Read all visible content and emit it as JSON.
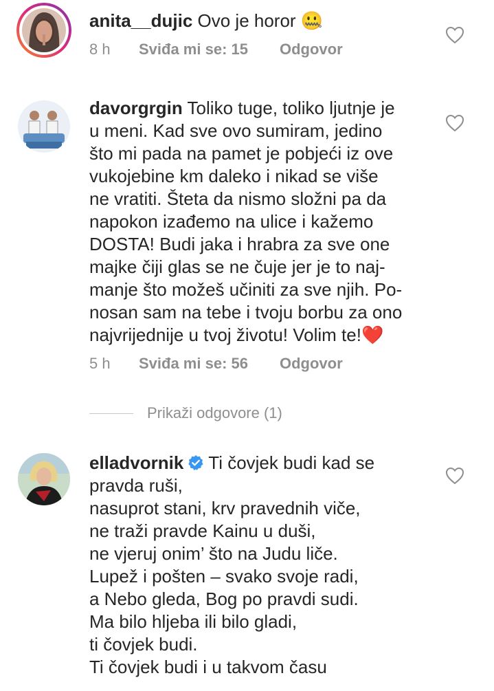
{
  "comments": [
    {
      "username": "anita__dujic",
      "text": " Ovo je horor 🤐",
      "time": "8 h",
      "likes": "Sviđa mi se: 15",
      "reply": "Odgovor"
    },
    {
      "username": "davorgrgin",
      "text": " Toliko tuge, toliko ljutnje je\nu meni. Kad sve ovo sumiram, jedino\nšto mi pada na pamet je pobjeći iz ove\nvukojebine km daleko i nikad se više\nne vratiti. Šteta da nismo složni pa da\nnapokon izađemo na ulice i kažemo\nDOSTA! Budi jaka i hrabra za sve one\nmajke čiji glas se ne čuje jer je to naj-\nmanje što možeš učiniti za sve njih. Po-\nnosan sam na tebe i tvoju borbu za ono\nnajvrijednije u tvoj životu! Volim te!❤️",
      "time": "5 h",
      "likes": "Sviđa mi se: 56",
      "reply": "Odgovor",
      "view_replies": "Prikaži odgovore (1)"
    },
    {
      "username": "elladvornik",
      "verified_icon": "verified-badge-icon",
      "text": "Ti čovjek budi kad se\npravda ruši,\nnasuprot stani, krv pravednih viče,\nne traži pravde Kainu u duši,\nne vjeruj onim’ što na Judu liče.\nLupež i pošten – svako svoje radi,\na Nebo gleda, Bog po pravdi sudi.\nMa bilo hljeba ili bilo gladi,\nti čovjek budi.\nTi čovjek budi i u takvom času"
    }
  ],
  "icons": {
    "like": "heart-outline-icon",
    "verified": "verified-badge-icon"
  },
  "colors": {
    "meta": "#8e8e8e",
    "verified": "#3897f0",
    "story_ring_start": "#f58529",
    "story_ring_end": "#dd2a7b"
  }
}
